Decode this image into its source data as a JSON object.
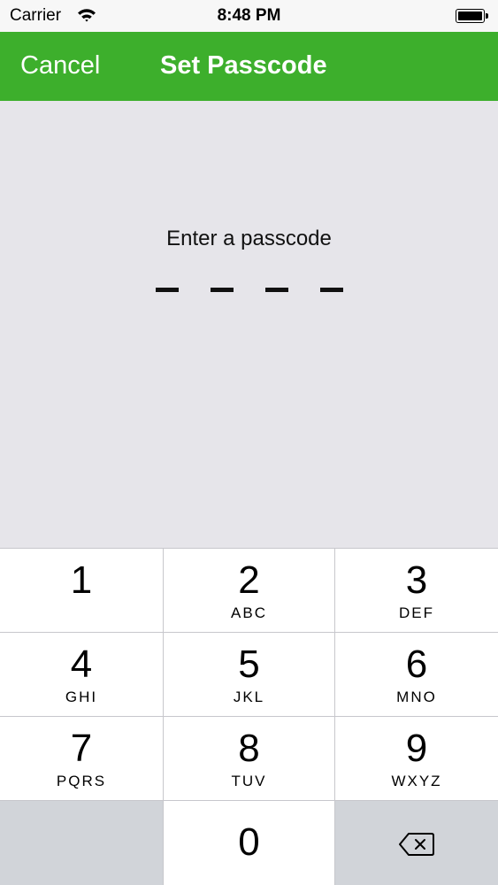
{
  "status_bar": {
    "carrier": "Carrier",
    "time": "8:48 PM",
    "battery_level": 1.0
  },
  "nav_bar": {
    "cancel_label": "Cancel",
    "title": "Set Passcode",
    "color": "#3daf2c"
  },
  "passcode": {
    "prompt": "Enter a passcode",
    "digits_entered": 0,
    "digits_total": 4
  },
  "keypad": {
    "keys": [
      {
        "digit": "1",
        "letters": ""
      },
      {
        "digit": "2",
        "letters": "ABC"
      },
      {
        "digit": "3",
        "letters": "DEF"
      },
      {
        "digit": "4",
        "letters": "GHI"
      },
      {
        "digit": "5",
        "letters": "JKL"
      },
      {
        "digit": "6",
        "letters": "MNO"
      },
      {
        "digit": "7",
        "letters": "PQRS"
      },
      {
        "digit": "8",
        "letters": "TUV"
      },
      {
        "digit": "9",
        "letters": "WXYZ"
      },
      {
        "digit": "0",
        "letters": ""
      }
    ],
    "backspace_icon": "backspace-icon"
  }
}
